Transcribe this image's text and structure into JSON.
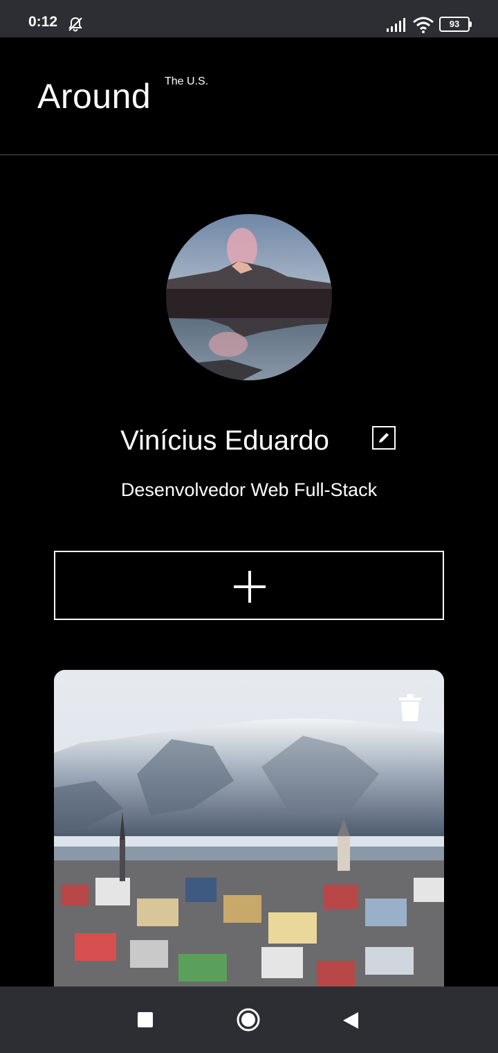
{
  "status_bar": {
    "time": "0:12",
    "battery": "93",
    "icons": [
      "notifications-muted-icon",
      "signal-icon",
      "wifi-icon",
      "battery-icon"
    ]
  },
  "header": {
    "logo": "Around",
    "logo_superscript": "The U.S."
  },
  "profile": {
    "name": "Vinícius Eduardo",
    "about": "Desenvolvedor Web Full-Stack",
    "edit_icon": "pencil-icon"
  },
  "add_button": {
    "icon": "plus-icon"
  },
  "cards": [
    {
      "image": "snowy mountains over colorful town",
      "delete_icon": "trash-icon"
    }
  ],
  "nav_bar": {
    "icons": [
      "recent-apps-icon",
      "home-icon",
      "back-icon"
    ]
  },
  "colors": {
    "background": "#000000",
    "system_bar": "#2c2e33",
    "text": "#ffffff",
    "divider": "#545454"
  }
}
